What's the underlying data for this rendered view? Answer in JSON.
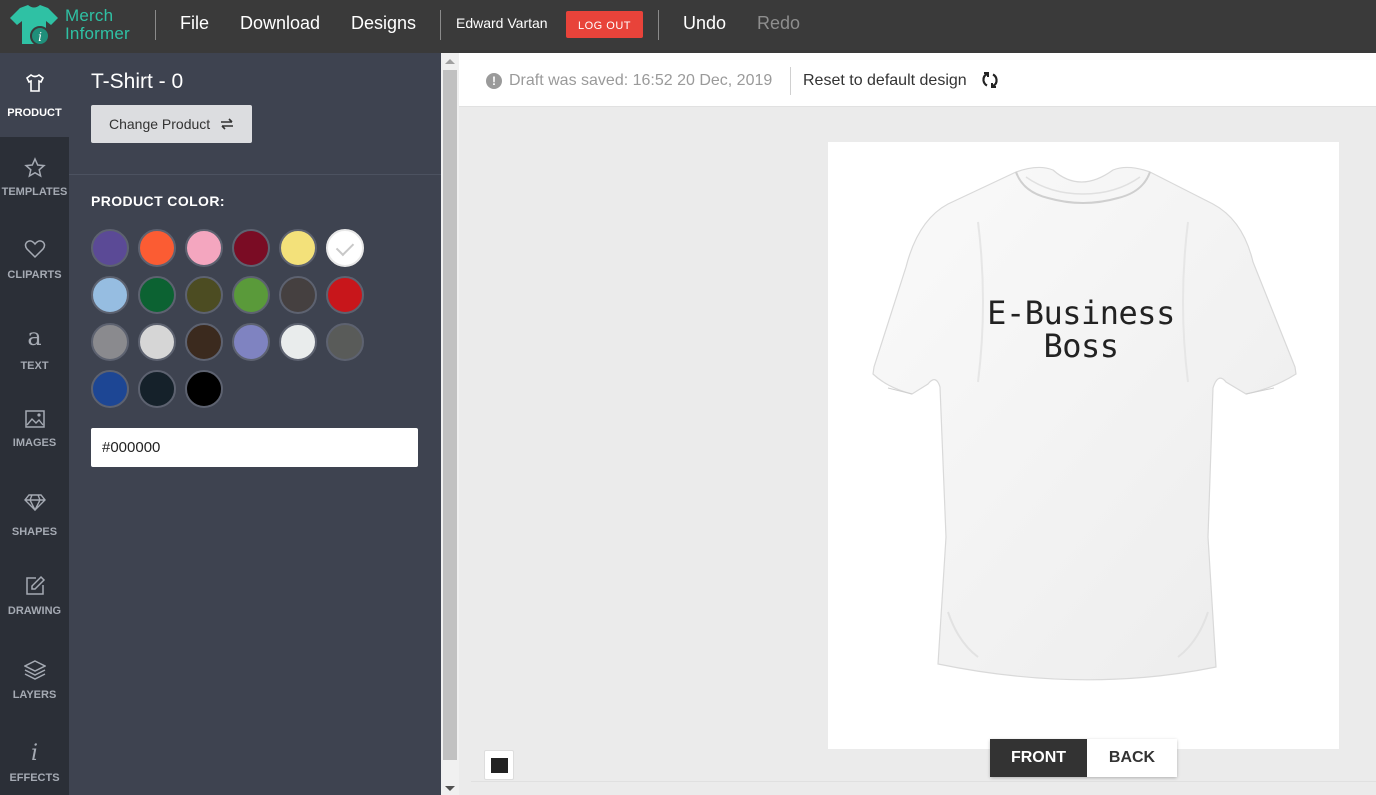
{
  "app": {
    "brand_line1": "Merch",
    "brand_line2": "Informer",
    "brand_color": "#2fc1a4"
  },
  "topbar": {
    "menu": [
      "File",
      "Download",
      "Designs"
    ],
    "username": "Edward Vartan",
    "logout_label": "LOG OUT",
    "undo_label": "Undo",
    "redo_label": "Redo"
  },
  "rail": {
    "items": [
      {
        "label": "PRODUCT",
        "icon": "tshirt-icon",
        "active": true
      },
      {
        "label": "TEMPLATES",
        "icon": "star-icon"
      },
      {
        "label": "CLIPARTS",
        "icon": "heart-icon"
      },
      {
        "label": "TEXT",
        "icon": "text-icon"
      },
      {
        "label": "IMAGES",
        "icon": "image-icon"
      },
      {
        "label": "SHAPES",
        "icon": "diamond-icon"
      },
      {
        "label": "DRAWING",
        "icon": "edit-icon"
      },
      {
        "label": "LAYERS",
        "icon": "layers-icon"
      },
      {
        "label": "EFFECTS",
        "icon": "effects-icon"
      }
    ]
  },
  "panel": {
    "title": "T-Shirt - 0",
    "change_product_label": "Change Product",
    "product_color_label": "PRODUCT COLOR:",
    "hex_value": "#000000",
    "swatches": [
      "#5b4a96",
      "#fb5c33",
      "#f4a6bf",
      "#7a0c24",
      "#f3e17a",
      "#ffffff",
      "#96bde1",
      "#0c6232",
      "#4c4c22",
      "#5a9a3a",
      "#454040",
      "#c8161b",
      "#8a8a8e",
      "#d6d6d6",
      "#3b2a1e",
      "#7f83c1",
      "#e9ecec",
      "#595b59",
      "#1d4694",
      "#15212a",
      "#000000"
    ],
    "selected_swatch": "#ffffff"
  },
  "workspace": {
    "draft_text": "Draft was saved: 16:52 20 Dec, 2019",
    "reset_label": "Reset to default design",
    "print_line1": "E-Business",
    "print_line2": "Boss",
    "front_label": "FRONT",
    "back_label": "BACK",
    "active_view": "FRONT"
  }
}
